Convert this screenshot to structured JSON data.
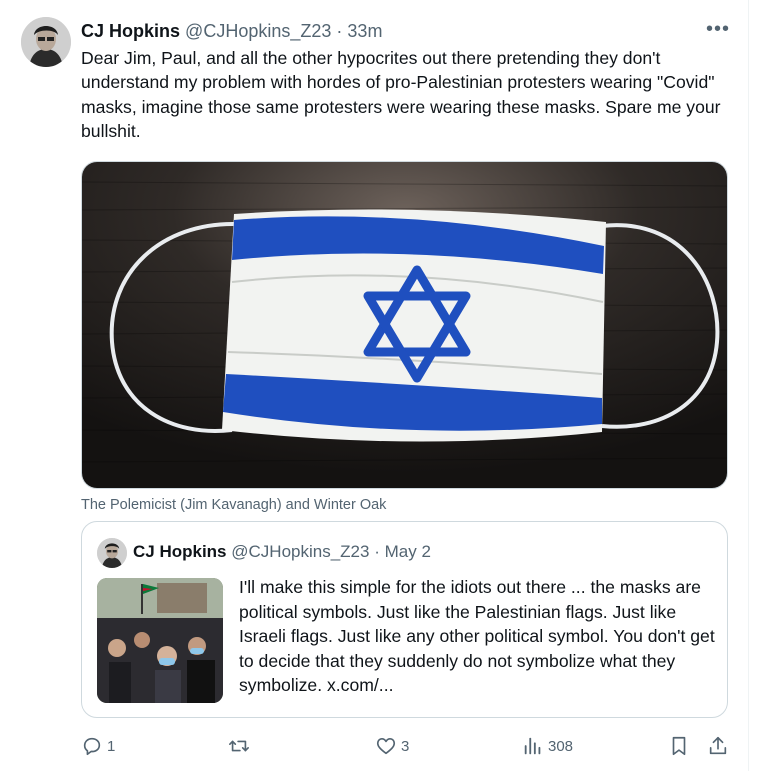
{
  "author": {
    "name": "CJ Hopkins",
    "handle": "@CJHopkins_Z23",
    "separator": "·",
    "time": "33m"
  },
  "more_label": "•••",
  "tweet_text": "Dear Jim, Paul, and all the other hypocrites out there pretending they don't understand my problem with hordes of pro-Palestinian protesters wearing \"Covid\" masks, imagine those same protesters were wearing these masks. Spare me your bullshit.",
  "media_caption": "The Polemicist (Jim Kavanagh) and Winter Oak",
  "quote": {
    "name": "CJ Hopkins",
    "handle": "@CJHopkins_Z23",
    "separator": "·",
    "date": "May 2",
    "text": "I'll make this simple for the idiots out there ... the masks are political symbols. Just like the Palestinian flags. Just like Israeli flags. Just like any other political symbol. You don't get to decide that they suddenly do not symbolize what they symbolize.  x.com/..."
  },
  "actions": {
    "replies": "1",
    "reposts": "",
    "likes": "3",
    "views": "308"
  },
  "colors": {
    "text": "#0f1419",
    "secondary": "#536471",
    "border": "#cfd9de",
    "flag_blue": "#1f4fbf"
  },
  "icons": [
    "reply-icon",
    "repost-icon",
    "like-icon",
    "views-icon",
    "bookmark-icon",
    "share-icon"
  ]
}
